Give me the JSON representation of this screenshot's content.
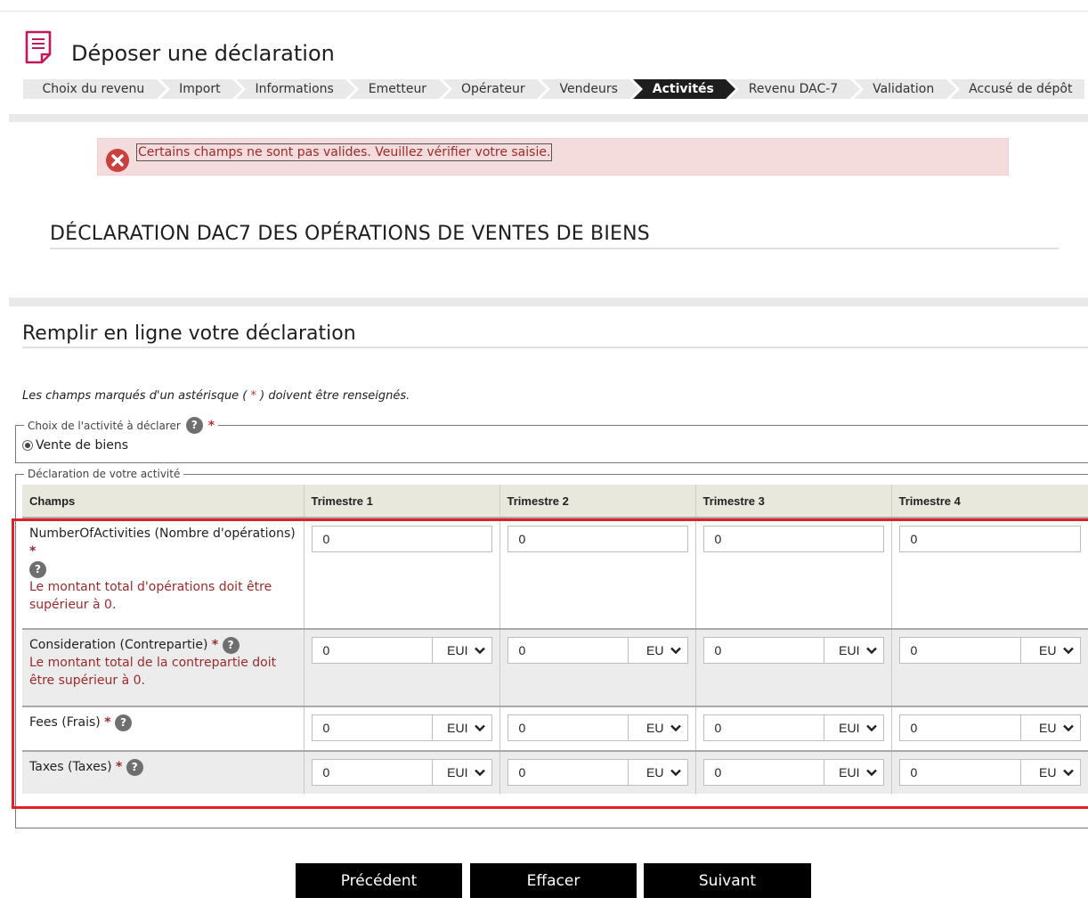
{
  "header": {
    "title": "Déposer une déclaration"
  },
  "stepper": [
    {
      "label": "Choix du revenu",
      "active": false
    },
    {
      "label": "Import",
      "active": false
    },
    {
      "label": "Informations",
      "active": false
    },
    {
      "label": "Emetteur",
      "active": false
    },
    {
      "label": "Opérateur",
      "active": false
    },
    {
      "label": "Vendeurs",
      "active": false
    },
    {
      "label": "Activités",
      "active": true
    },
    {
      "label": "Revenu DAC-7",
      "active": false
    },
    {
      "label": "Validation",
      "active": false
    },
    {
      "label": "Accusé de dépôt",
      "active": false
    }
  ],
  "error": {
    "message": "Certains champs ne sont pas valides. Veuillez vérifier votre saisie."
  },
  "section": {
    "title": "DÉCLARATION DAC7 DES OPÉRATIONS DE VENTES DE BIENS",
    "fill_title": "Remplir en ligne votre déclaration",
    "required_note_before": "Les champs marqués d'un astérisque ( ",
    "required_note_star": "*",
    "required_note_after": " ) doivent être renseignés."
  },
  "activity_choice": {
    "legend": "Choix de l'activité à déclarer",
    "star": "*",
    "option": "Vente de biens"
  },
  "declaration": {
    "legend": "Déclaration de votre activité",
    "headers": [
      "Champs",
      "Trimestre 1",
      "Trimestre 2",
      "Trimestre 3",
      "Trimestre 4"
    ],
    "rows": [
      {
        "label": "NumberOfActivities (Nombre d'opérations)",
        "star": "*",
        "error": "Le montant total d'opérations doit être supérieur à 0.",
        "values": [
          "0",
          "0",
          "0",
          "0"
        ]
      },
      {
        "label": "Consideration (Contrepartie)",
        "star": "*",
        "error": "Le montant total de la contrepartie doit être supérieur à 0.",
        "values": [
          "0",
          "0",
          "0",
          "0"
        ],
        "currency": [
          "EUI",
          "EU",
          "EUI",
          "EU"
        ]
      },
      {
        "label": "Fees (Frais)",
        "star": "*",
        "values": [
          "0",
          "0",
          "0",
          "0"
        ],
        "currency": [
          "EUI",
          "EU",
          "EUI",
          "EU"
        ]
      },
      {
        "label": "Taxes (Taxes)",
        "star": "*",
        "values": [
          "0",
          "0",
          "0",
          "0"
        ],
        "currency": [
          "EUI",
          "EU",
          "EUI",
          "EU"
        ]
      }
    ],
    "help_glyph": "?"
  },
  "buttons": {
    "prev": "Précédent",
    "clear": "Effacer",
    "next": "Suivant"
  },
  "colors": {
    "accent": "#1e1e1e",
    "error_text": "#9c2a2a",
    "error_bg": "#f4dcdc",
    "highlight_frame": "#e0202a",
    "header_bg": "#e8e8dc"
  },
  "icons": {
    "title": "document-icon",
    "error": "error-circle-icon",
    "help": "help-icon",
    "select": "chevron-down-icon"
  }
}
